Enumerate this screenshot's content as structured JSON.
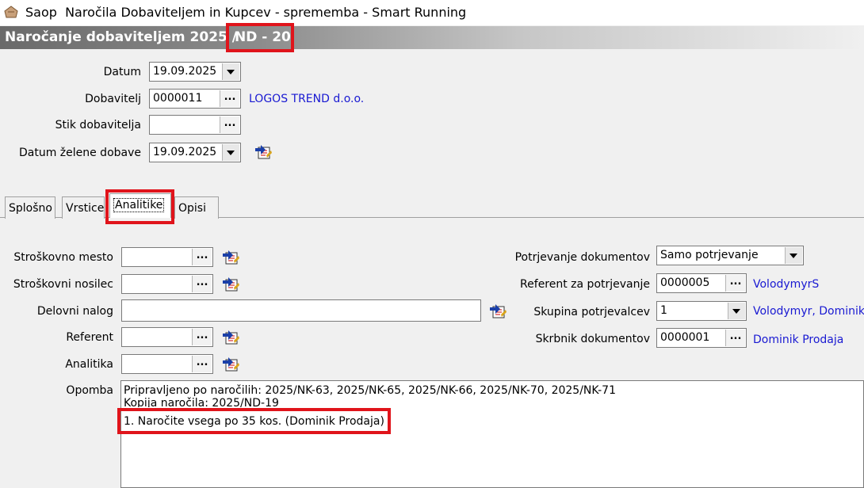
{
  "window": {
    "app": "Saop",
    "title": "Naročila Dobaviteljem in Kupcev - sprememba - Smart Running"
  },
  "header": {
    "doc_type": "Naročanje dobaviteljem 2025 /",
    "doc_number": "ND - 20"
  },
  "form": {
    "datum": {
      "label": "Datum",
      "value": "19.09.2025"
    },
    "dobavitelj": {
      "label": "Dobavitelj",
      "value": "0000011",
      "name": "LOGOS TREND d.o.o."
    },
    "stik": {
      "label": "Stik dobavitelja",
      "value": ""
    },
    "datum_dobave": {
      "label": "Datum želene dobave",
      "value": "19.09.2025"
    }
  },
  "tabs": [
    {
      "label": "Splošno"
    },
    {
      "label": "Vrstice"
    },
    {
      "label": "Analitike",
      "active": true
    },
    {
      "label": "Opisi"
    }
  ],
  "analitike": {
    "stroskovno_mesto": {
      "label": "Stroškovno mesto",
      "value": ""
    },
    "stroskovni_nosilec": {
      "label": "Stroškovni nosilec",
      "value": ""
    },
    "delovni_nalog": {
      "label": "Delovni nalog",
      "value": ""
    },
    "referent": {
      "label": "Referent",
      "value": ""
    },
    "analitika": {
      "label": "Analitika",
      "value": ""
    },
    "potrjevanje": {
      "label": "Potrjevanje dokumentov",
      "value": "Samo potrjevanje"
    },
    "referent_potrj": {
      "label": "Referent za potrjevanje",
      "value": "0000005",
      "name": "VolodymyrS"
    },
    "skupina": {
      "label": "Skupina potrjevalcev",
      "value": "1",
      "name": "Volodymyr, Dominik"
    },
    "skrbnik": {
      "label": "Skrbnik dokumentov",
      "value": "0000001",
      "name": "Dominik Prodaja"
    },
    "opomba": {
      "label": "Opomba",
      "lines": [
        "Pripravljeno po naročilih: 2025/NK-63, 2025/NK-65, 2025/NK-66, 2025/NK-70, 2025/NK-71",
        "Kopija naročila: 2025/ND-19",
        "1. Naročite vsega po 35 kos. (Dominik Prodaja)"
      ]
    }
  },
  "buttons": {
    "dots": "..."
  },
  "colors": {
    "highlight": "#e0141b",
    "link": "#1919d2"
  },
  "icons": [
    "app-icon",
    "dropdown-arrow-icon",
    "ellipsis-icon",
    "picker-icon"
  ]
}
